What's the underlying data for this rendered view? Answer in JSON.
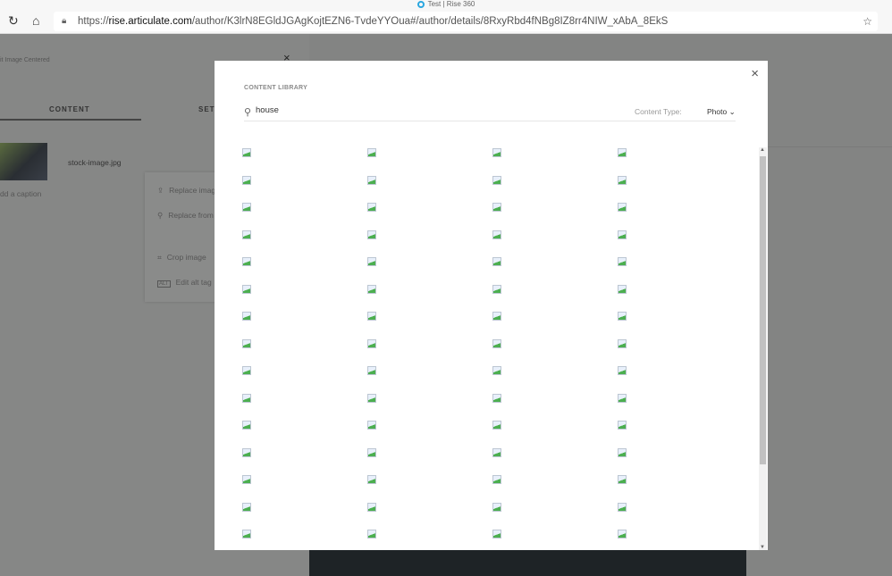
{
  "browser": {
    "tab_title": "Test | Rise 360",
    "url_domain": "rise.articulate.com",
    "url_path": "/author/K3lrN8EGldJGAgKojtEZN6-TvdeYYOua#/author/details/8RxyRbd4fNBg8IZ8rr4NIW_xAbA_8EkS",
    "url_scheme": "https://"
  },
  "sidebar": {
    "block_title": "it Image Centered",
    "close": "×",
    "tabs": [
      "CONTENT",
      "SETT"
    ],
    "file_name": "stock-image.jpg",
    "caption_placeholder": "dd a caption",
    "menu": [
      {
        "icon": "⇪",
        "label": "Replace imag"
      },
      {
        "icon": "⚲",
        "label": "Replace from"
      },
      {
        "icon": "⌗",
        "label": "Crop image"
      },
      {
        "icon": "ALT",
        "label": "Edit alt tag"
      }
    ]
  },
  "modal": {
    "title": "CONTENT LIBRARY",
    "search_value": "house",
    "content_type_label": "Content Type:",
    "content_type_value": "Photo",
    "close": "×",
    "image_rows": 15,
    "image_cols": 4
  }
}
